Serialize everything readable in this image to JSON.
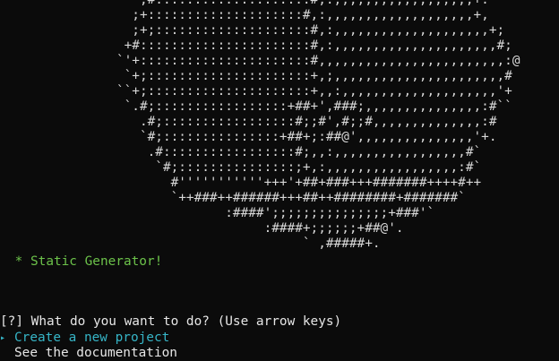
{
  "terminal": {
    "ascii_art": [
      "                  ;#::::::::::::::::::::#,:,,,,,,,,,,,,,,,,,,+.",
      "                 ;+::::::::::::::::::::#,:,,,,,,,,,,,,,,,,,,,+,",
      "                 ;+;::::::::::::::::::::#,:,,,,,,,,,,,,,,,,,,,,+;",
      "                +#::::::::::::::::::::::#,:,,,,,,,,,,,,,,,,,,,,,#;",
      "               `'+::::::::::::::::::::::#,,,,,,,,,,,,,,,,,,,,,,,,:@",
      "                `+;:::::::::::::::::::::+,;,,,,,,,,,,,,,,,,,,,,,,#",
      "               ``+;:::::::::::::::::::::+,,:,,,,,,,,,,,,,,,,,,,,'+",
      "                `.#;:::::::::::::::::+##+',###;,,,,,,,,,,,,,,,:#``",
      "                  .#;:::::::::::::::::#;;#',#;;#,,,,,,,,,,,,,,:#",
      "                  `#;:::::::::::::::+##+;:##@',,,,,,,,,,,,,,,'+.",
      "                   .#:::::::::::::::::#;,,:,,,,,,,,,,,,,,,,,#`",
      "                    `#;:::::::::::::::;+,:,,,,,,,,,,,,,,,,,:#`",
      "                      #'''''''''''+++'+##+###+++#######++++#++",
      "                      `++###++######+++##++########+#######`",
      "                             :####';;;;;;;;;;;;;;;+###'`",
      "                                  :####+;;;;;;+##@'.",
      "                                       ` ,#####+."
    ],
    "banner": " * Static Generator!",
    "prompt": "[?] What do you want to do? (Use arrow keys)",
    "options": [
      {
        "label": "Create a new project",
        "selected": true,
        "pointer": "▸"
      },
      {
        "label": "See the documentation",
        "selected": false
      }
    ],
    "colors": {
      "background": "#0b0b0b",
      "text": "#e6e6e6",
      "banner": "#6cc24a",
      "selected_option": "#36b5c7"
    }
  }
}
